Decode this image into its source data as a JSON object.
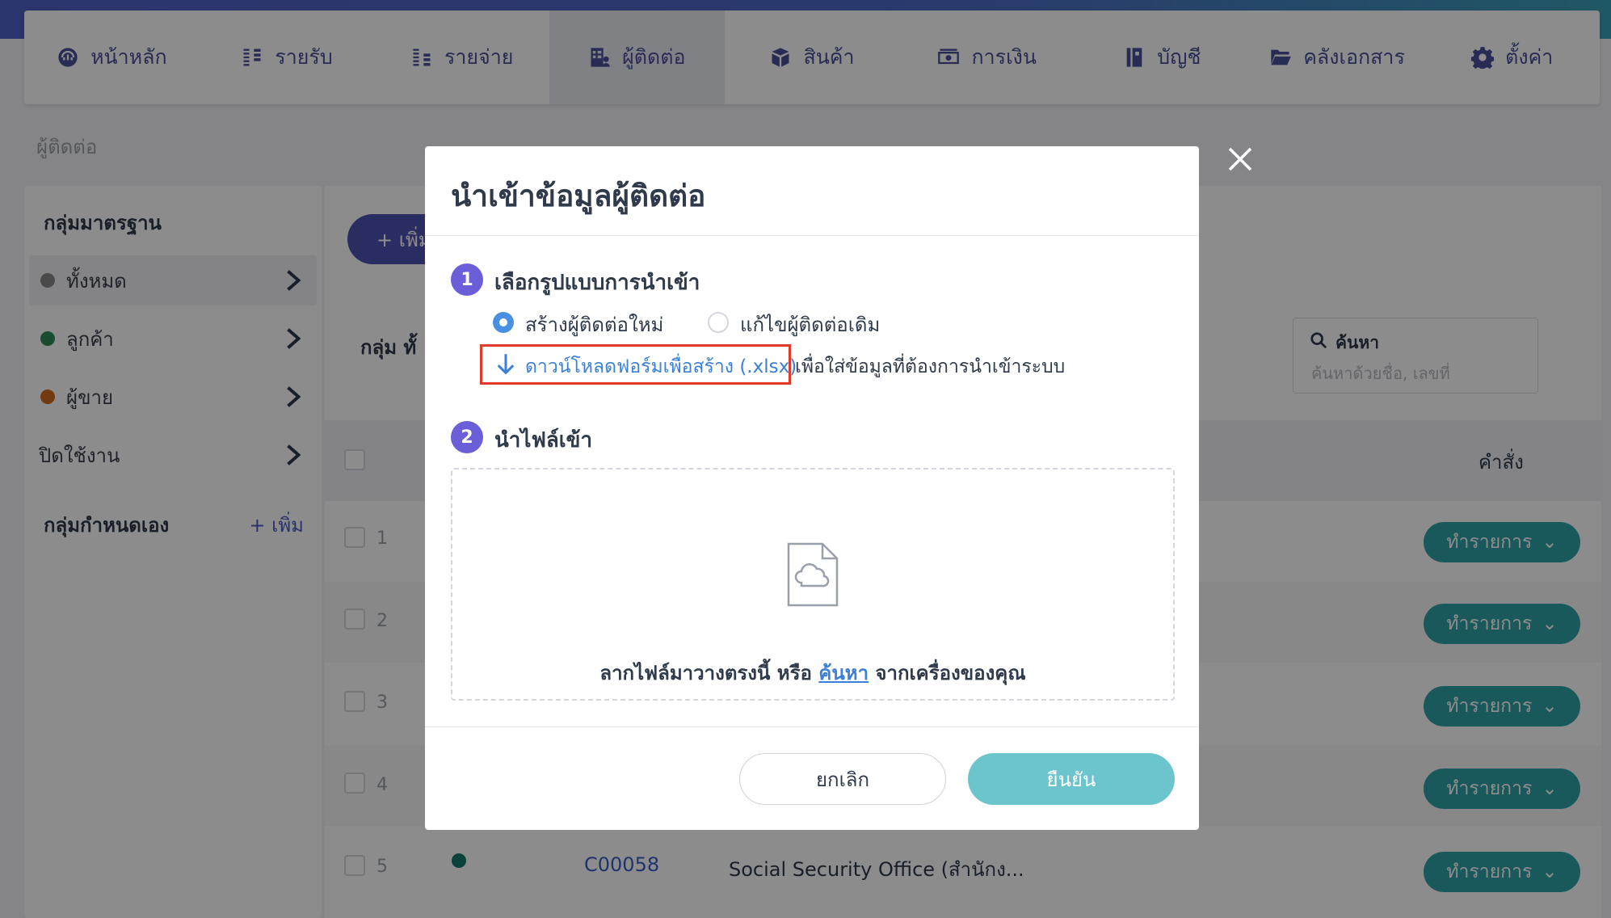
{
  "nav": {
    "items": [
      {
        "label": "หน้าหลัก",
        "icon": "dashboard-icon",
        "active": false
      },
      {
        "label": "รายรับ",
        "icon": "income-icon",
        "active": false
      },
      {
        "label": "รายจ่าย",
        "icon": "expense-icon",
        "active": false
      },
      {
        "label": "ผู้ติดต่อ",
        "icon": "contacts-icon",
        "active": true
      },
      {
        "label": "สินค้า",
        "icon": "box-icon",
        "active": false
      },
      {
        "label": "การเงิน",
        "icon": "money-icon",
        "active": false
      },
      {
        "label": "บัญชี",
        "icon": "ledger-icon",
        "active": false
      },
      {
        "label": "คลังเอกสาร",
        "icon": "folder-icon",
        "active": false
      },
      {
        "label": "ตั้งค่า",
        "icon": "gear-icon",
        "active": false
      }
    ]
  },
  "breadcrumb": "ผู้ติดต่อ",
  "sidebar": {
    "standard_title": "กลุ่มมาตรฐาน",
    "standard_items": [
      {
        "label": "ทั้งหมด",
        "dot_color": "#888888",
        "selected": true
      },
      {
        "label": "ลูกค้า",
        "dot_color": "#2e8b57",
        "selected": false
      },
      {
        "label": "ผู้ขาย",
        "dot_color": "#d2691e",
        "selected": false
      },
      {
        "label": "ปิดใช้งาน",
        "dot_color": null,
        "selected": false
      }
    ],
    "custom_title": "กลุ่มกำหนดเอง",
    "custom_add": "+ เพิ่ม"
  },
  "main": {
    "add_button": "+ เพิ่ม",
    "group_label": "กลุ่ม ทั้",
    "search": {
      "label": "ค้นหา",
      "placeholder": "ค้นหาด้วยชื่อ, เลขที่"
    },
    "column_command": "คำสั่ง",
    "rows": [
      {
        "num": "1",
        "action": "ทำรายการ"
      },
      {
        "num": "2",
        "action": "ทำรายการ"
      },
      {
        "num": "3",
        "action": "ทำรายการ"
      },
      {
        "num": "4",
        "action": "ทำรายการ"
      },
      {
        "num": "5",
        "action": "ทำรายการ",
        "code": "C00058",
        "name": "Social Security Office (สำนักง..."
      }
    ]
  },
  "modal": {
    "title": "นำเข้าข้อมูลผู้ติดต่อ",
    "step1": {
      "num": "1",
      "title": "เลือกรูปแบบการนำเข้า"
    },
    "options": [
      {
        "label": "สร้างผู้ติดต่อใหม่",
        "selected": true
      },
      {
        "label": "แก้ไขผู้ติดต่อเดิม",
        "selected": false
      }
    ],
    "download_link": "ดาวน์โหลดฟอร์มเพื่อสร้าง (.xlsx)",
    "download_rest": "เพื่อใส่ข้อมูลที่ต้องการนำเข้าระบบ",
    "step2": {
      "num": "2",
      "title": "นำไฟล์เข้า"
    },
    "drop_prefix": "ลากไฟล์มาวางตรงนี้ หรือ",
    "drop_link": "ค้นหา",
    "drop_suffix": "จากเครื่องของคุณ",
    "cancel": "ยกเลิก",
    "confirm": "ยืนยัน"
  }
}
